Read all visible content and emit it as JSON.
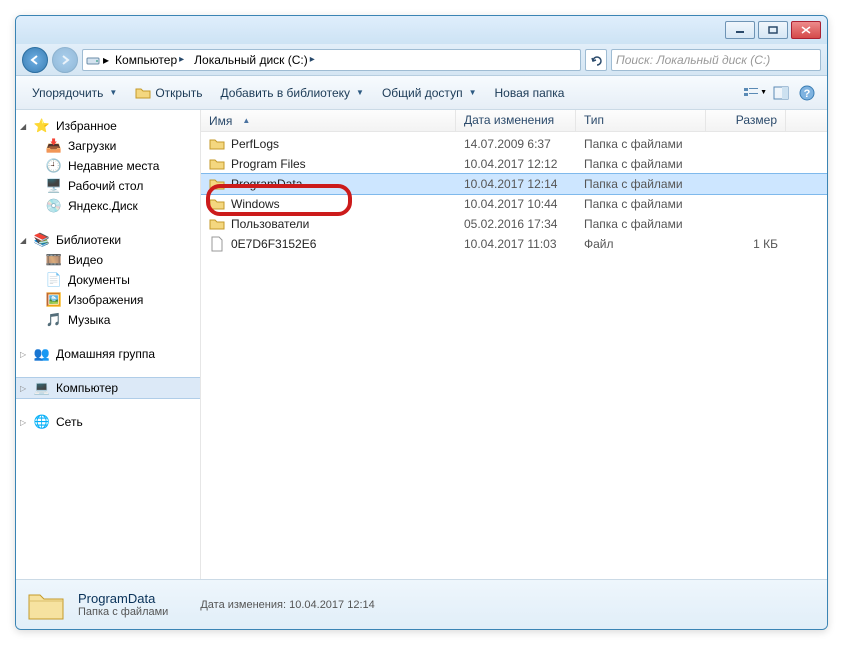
{
  "titlebar": {},
  "nav": {
    "crumb1": "Компьютер",
    "crumb2": "Локальный диск (C:)",
    "search_placeholder": "Поиск: Локальный диск (C:)"
  },
  "toolbar": {
    "organize": "Упорядочить",
    "open": "Открыть",
    "add_to_library": "Добавить в библиотеку",
    "share": "Общий доступ",
    "new_folder": "Новая папка"
  },
  "sidebar": {
    "favorites": "Избранное",
    "downloads": "Загрузки",
    "recent": "Недавние места",
    "desktop": "Рабочий стол",
    "yadisk": "Яндекс.Диск",
    "libraries": "Библиотеки",
    "video": "Видео",
    "documents": "Документы",
    "pictures": "Изображения",
    "music": "Музыка",
    "homegroup": "Домашняя группа",
    "computer": "Компьютер",
    "network": "Сеть"
  },
  "columns": {
    "name": "Имя",
    "date": "Дата изменения",
    "type": "Тип",
    "size": "Размер"
  },
  "rows": [
    {
      "name": "PerfLogs",
      "date": "14.07.2009 6:37",
      "type": "Папка с файлами",
      "size": "",
      "kind": "folder"
    },
    {
      "name": "Program Files",
      "date": "10.04.2017 12:12",
      "type": "Папка с файлами",
      "size": "",
      "kind": "folder"
    },
    {
      "name": "ProgramData",
      "date": "10.04.2017 12:14",
      "type": "Папка с файлами",
      "size": "",
      "kind": "folder",
      "selected": true
    },
    {
      "name": "Windows",
      "date": "10.04.2017 10:44",
      "type": "Папка с файлами",
      "size": "",
      "kind": "folder"
    },
    {
      "name": "Пользователи",
      "date": "05.02.2016 17:34",
      "type": "Папка с файлами",
      "size": "",
      "kind": "folder"
    },
    {
      "name": "0E7D6F3152E6",
      "date": "10.04.2017 11:03",
      "type": "Файл",
      "size": "1 КБ",
      "kind": "file"
    }
  ],
  "status": {
    "title": "ProgramData",
    "sub": "Папка с файлами",
    "meta_label": "Дата изменения:",
    "meta_value": "10.04.2017 12:14"
  }
}
